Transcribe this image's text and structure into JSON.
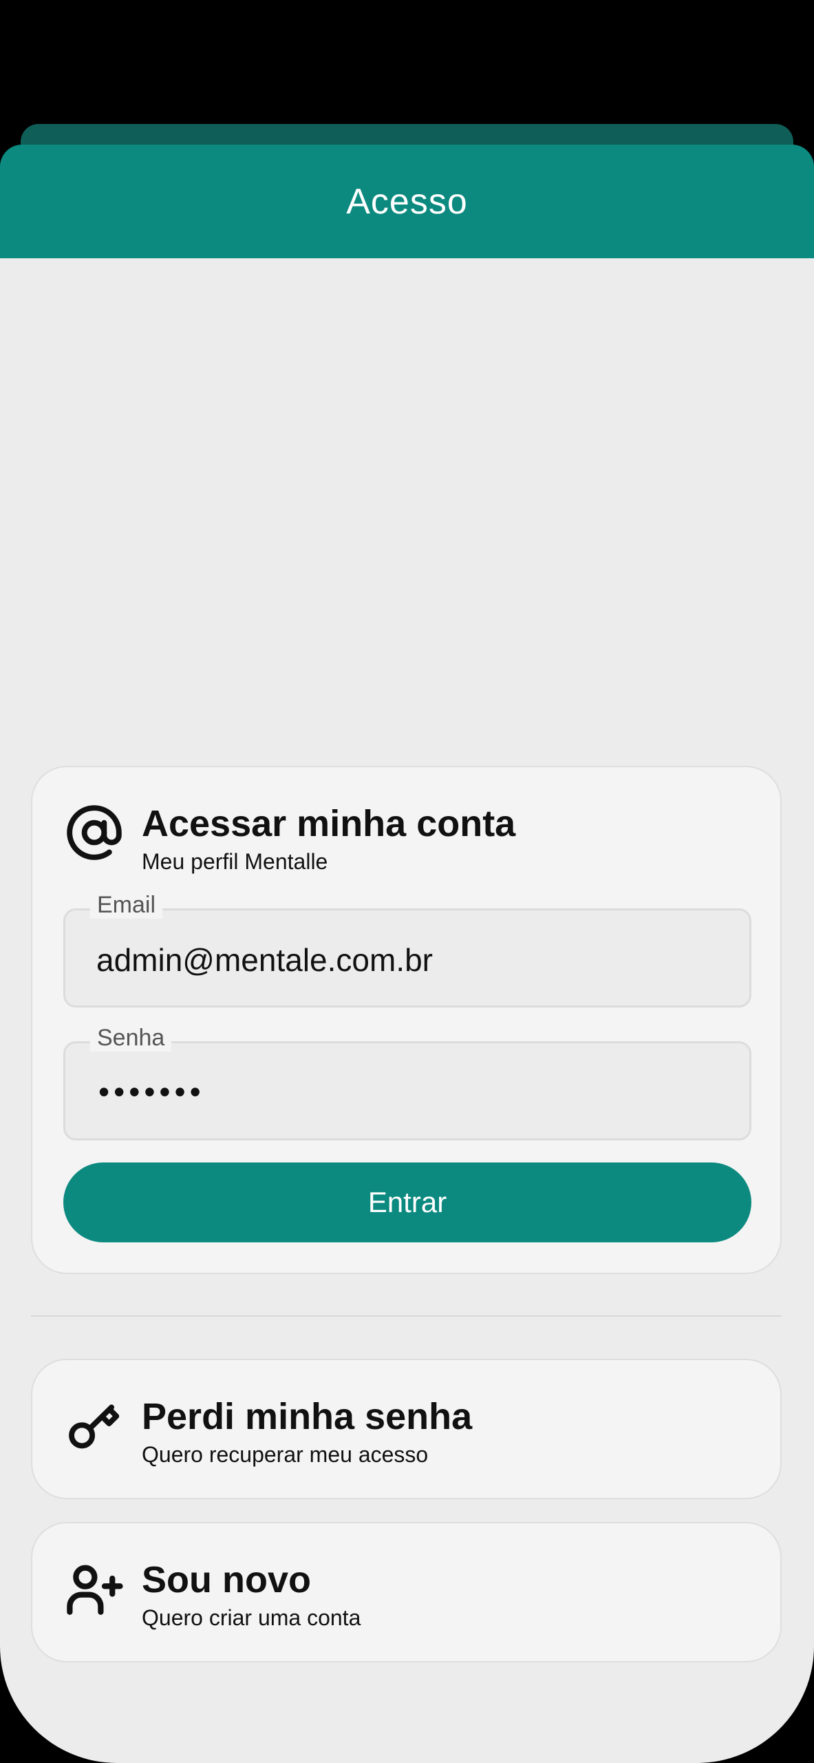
{
  "header": {
    "title": "Acesso"
  },
  "login": {
    "title": "Acessar minha conta",
    "subtitle": "Meu perfil Mentalle",
    "email_label": "Email",
    "email_value": "admin@mentale.com.br",
    "password_label": "Senha",
    "password_masked": "•••••••",
    "submit_label": "Entrar",
    "icon": "at-sign-icon"
  },
  "options": {
    "lost_password": {
      "title": "Perdi minha senha",
      "subtitle": "Quero recuperar meu acesso",
      "icon": "key-icon"
    },
    "new_user": {
      "title": "Sou novo",
      "subtitle": "Quero criar uma conta",
      "icon": "user-plus-icon"
    }
  },
  "colors": {
    "primary": "#0c8a80",
    "primary_dark": "#0f5f58",
    "background": "#ececec",
    "card": "#f4f4f4"
  }
}
